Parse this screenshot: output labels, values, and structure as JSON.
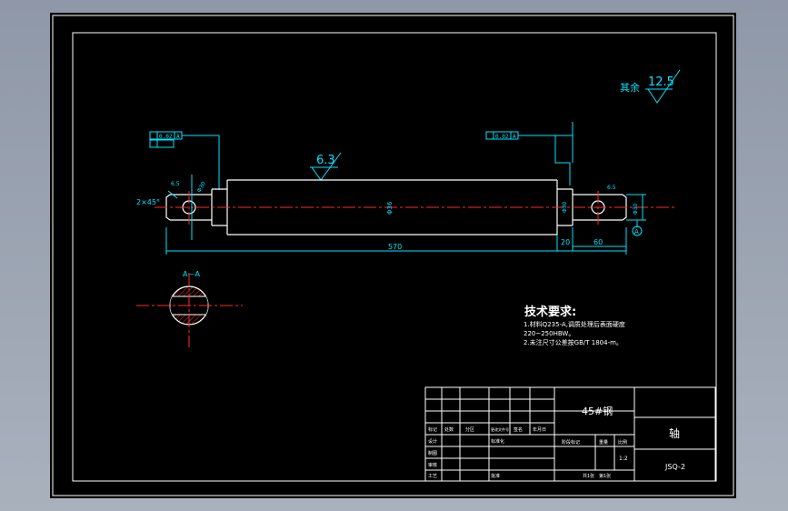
{
  "drawing": {
    "roughness": {
      "general_prefix": "其余",
      "general_value": "12.5",
      "surface_value": "6.3"
    },
    "tolerance_frames": {
      "left": [
        "0.02",
        "A"
      ],
      "right": [
        "0.02",
        "A"
      ]
    },
    "dimensions": {
      "chamfer": "2×45°",
      "hole_left": "6.5",
      "hole_left_dia": "Φ30",
      "main_dia": "Φ36",
      "right_step_dia": "Φ30",
      "right_end_dia": "Φ30",
      "total_length": "570",
      "step_length": "20",
      "end_length": "60",
      "right_hole": "6.5",
      "datum": "A"
    },
    "section": {
      "label": "A—A"
    },
    "tech_requirements": {
      "title": "技术要求:",
      "lines": [
        "1.材料Q235-A,调质处理后表面硬度",
        "220~250HBW。",
        "2.未注尺寸公差按GB/T 1804-m。"
      ]
    },
    "title_block": {
      "material": "45#钢",
      "part_name": "轴",
      "drawing_no": "JSQ-2",
      "scale_label": "比例",
      "scale_value": "1:2",
      "stage_mark": "阶段标记",
      "weight_label": "重量",
      "sheets_total": "共1张",
      "sheet_no": "第1张",
      "row_headers": [
        "标记",
        "处数",
        "分区",
        "更改文件号",
        "签名",
        "年月日"
      ],
      "left_labels": [
        "设计",
        "审核",
        "工艺"
      ],
      "std_label": "标准化",
      "approve_label": "批准",
      "design_extra": "制图"
    }
  },
  "colors": {
    "background": "#000000",
    "outline": "#ffffff",
    "center": "#ff2a2a",
    "dimension": "#00e5ff",
    "chrome": "#a2aab6"
  }
}
